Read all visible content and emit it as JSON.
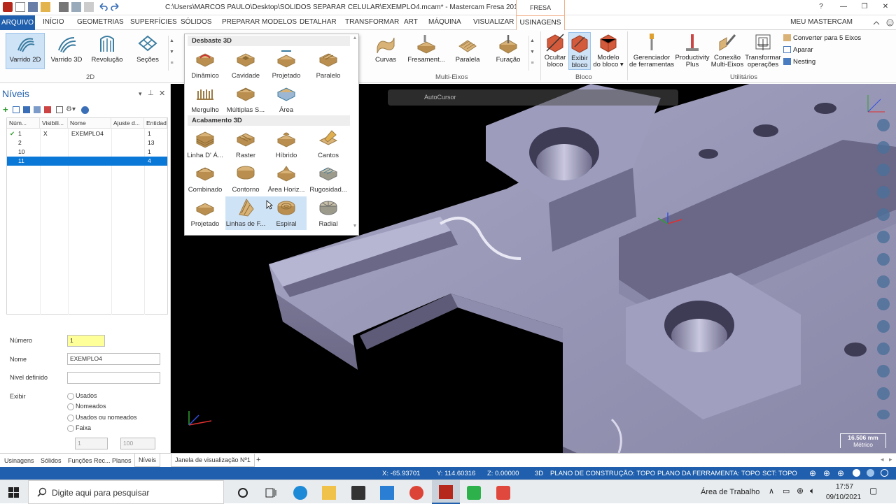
{
  "window": {
    "title": "C:\\Users\\MARCOS PAULO\\Desktop\\SOLIDOS SEPARAR CELULAR\\EXEMPLO4.mcam* - Mastercam Fresa 2018",
    "context_tab": "FRESA"
  },
  "menu": {
    "tabs": [
      "ARQUIVO",
      "INÍCIO",
      "GEOMETRIAS",
      "SUPERFÍCIES",
      "SÓLIDOS",
      "PREPARAR MODELOS",
      "DETALHAR",
      "TRANSFORMAR",
      "ART",
      "MÁQUINA",
      "VISUALIZAR",
      "USINAGENS"
    ],
    "account": "MEU MASTERCAM"
  },
  "ribbon": {
    "group_2d": {
      "label": "2D",
      "buttons": [
        "Varrido 2D",
        "Varrido 3D",
        "Revolução",
        "Seções"
      ]
    },
    "group_multi": {
      "label": "Multi-Eixos",
      "buttons": [
        "Curvas",
        "Fresament...",
        "Paralela",
        "Furação"
      ]
    },
    "group_bloco": {
      "label": "Bloco",
      "buttons": [
        [
          "Ocultar",
          "bloco"
        ],
        [
          "Exibir",
          "bloco"
        ],
        [
          "Modelo",
          "do bloco"
        ]
      ]
    },
    "group_util": {
      "label": "Utilitários",
      "buttons": [
        [
          "Gerenciador",
          "de ferramentas"
        ],
        [
          "Productivity",
          "Plus"
        ],
        [
          "Conexão",
          "Multi-Eixos"
        ],
        [
          "Transformar",
          "operações"
        ]
      ],
      "small": [
        "Converter para 5 Eixos",
        "Aparar",
        "Nesting"
      ]
    }
  },
  "dropdown": {
    "rough": {
      "title": "Desbaste 3D",
      "items": [
        "Dinâmico",
        "Cavidade",
        "Projetado",
        "Paralelo",
        "Mergulho",
        "Múltiplas S...",
        "Área"
      ]
    },
    "finish": {
      "title": "Acabamento 3D",
      "items": [
        "Linha D' Á...",
        "Raster",
        "Híbrido",
        "Cantos",
        "Combinado",
        "Contorno",
        "Área Horiz...",
        "Rugosidad...",
        "Projetado",
        "Linhas de F...",
        "Espiral",
        "Radial"
      ]
    }
  },
  "levels": {
    "title": "Níveis",
    "columns": [
      "Núm...",
      "Visibili...",
      "Nome",
      "Ajuste d...",
      "Entidade"
    ],
    "rows": [
      [
        "1",
        "X",
        "EXEMPLO4",
        "",
        "1"
      ],
      [
        "2",
        "",
        "",
        "",
        "13"
      ],
      [
        "10",
        "",
        "",
        "",
        "1"
      ],
      [
        "11",
        "",
        "",
        "",
        "4"
      ]
    ],
    "props": {
      "numero_label": "Número",
      "numero": "1",
      "nome_label": "Nome",
      "nome": "EXEMPLO4",
      "nivel_def_label": "Nivel definido",
      "nivel_def": "",
      "exibir_label": "Exibir",
      "options": [
        "Usados",
        "Nomeados",
        "Usados ou nomeados",
        "Faixa"
      ],
      "range_from": "1",
      "range_to": "100"
    }
  },
  "viewport": {
    "autocursor": "AutoCursor",
    "scale": "16.506 mm",
    "scale_unit": "Métrico"
  },
  "bottom_tabs": [
    "Usinagens",
    "Sólidos",
    "Funções Rec...",
    "Planos",
    "Níveis"
  ],
  "viewport_tab": "Janela de visualização Nº1",
  "status": {
    "x": "X:    -65.93701",
    "y": "Y:   114.60316",
    "z": "Z:   0.00000",
    "mode": "3D",
    "cplane": "PLANO DE CONSTRUÇÃO: TOPO",
    "tplane": "PLANO DA FERRAMENTA: TOPO",
    "sct": "SCT: TOPO"
  },
  "taskbar": {
    "search": "Digite aqui para pesquisar",
    "desktop": "Área de Trabalho",
    "time": "17:57",
    "date": "09/10/2021"
  },
  "colors": {
    "accent": "#1f5fad",
    "selection": "#0a78d7",
    "viewport_bg": "#000000",
    "part": "#8c8aa8"
  }
}
